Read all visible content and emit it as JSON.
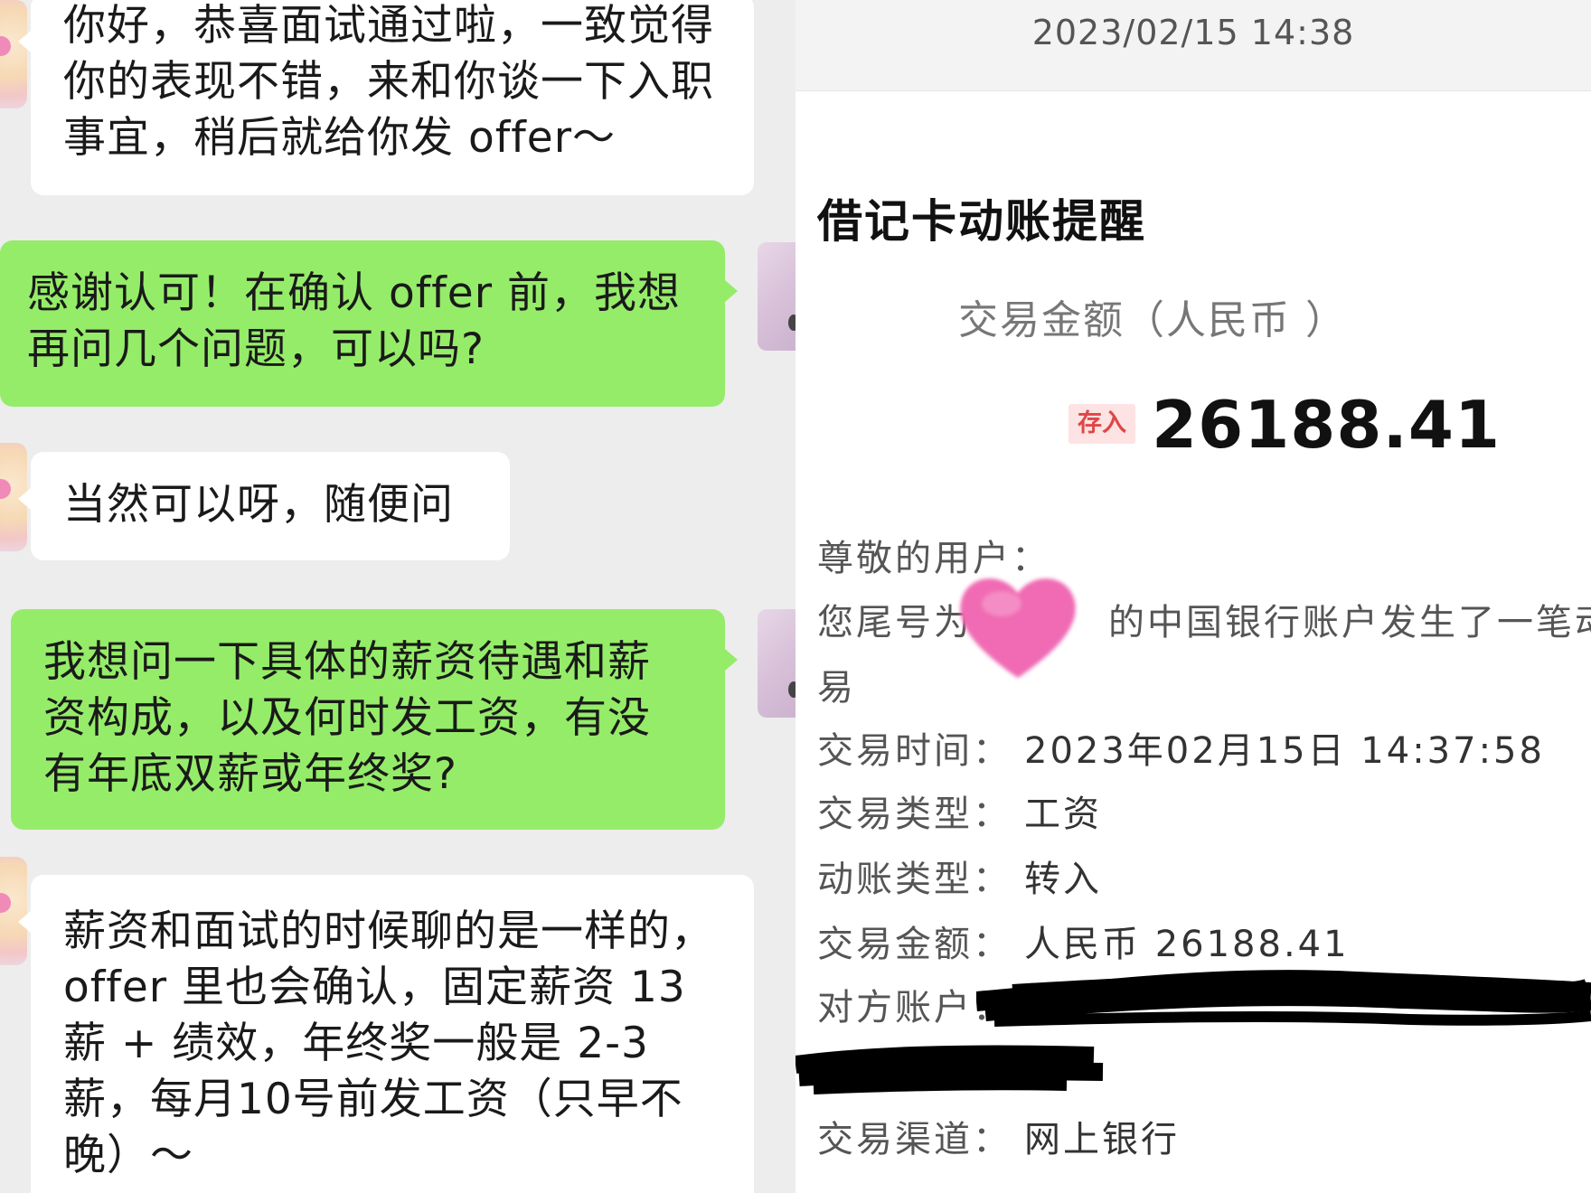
{
  "chat": {
    "messages": [
      {
        "side": "in",
        "text": "你好，恭喜面试通过啦，一致觉得你的表现不错，来和你谈一下入职事宜，稍后就给你发 offer～"
      },
      {
        "side": "out",
        "text": "感谢认可！在确认 offer 前，我想再问几个问题，可以吗?"
      },
      {
        "side": "in",
        "text": "当然可以呀，随便问"
      },
      {
        "side": "out",
        "text": "我想问一下具体的薪资待遇和薪资构成，以及何时发工资，有没有年底双薪或年终奖?"
      },
      {
        "side": "in",
        "text": "薪资和面试的时候聊的是一样的，offer 里也会确认，固定薪资 13 薪 + 绩效，年终奖一般是 2-3 薪，每月10号前发工资（只早不晚）～"
      }
    ],
    "colors": {
      "background": "#ededed",
      "incoming": "#ffffff",
      "outgoing": "#95ec69"
    }
  },
  "bank": {
    "timestamp": "2023/02/15 14:38",
    "title": "借记卡动账提醒",
    "amount_label": "交易金额（人民币 ）",
    "deposit_badge": "存入",
    "amount": "26188.41",
    "greeting": "尊敬的用户：",
    "notice_part1": "您尾号为",
    "notice_part2": "的中国银行账户发生了一笔动账交",
    "notice_part3": "易",
    "rows": [
      {
        "key": "交易时间：",
        "value": "2023年02月15日 14:37:58"
      },
      {
        "key": "交易类型：",
        "value": "工资"
      },
      {
        "key": "动账类型：",
        "value": "转入"
      },
      {
        "key": "交易金额：",
        "value": "人民币 26188.41"
      },
      {
        "key": "对方账户：",
        "value": ""
      },
      {
        "key": "交易渠道：",
        "value": "网上银行"
      }
    ],
    "colors": {
      "badge_bg": "#fde3e3",
      "badge_text": "#e04646",
      "redaction_heart": "#f06bb3",
      "redaction_ink": "#000000"
    }
  }
}
